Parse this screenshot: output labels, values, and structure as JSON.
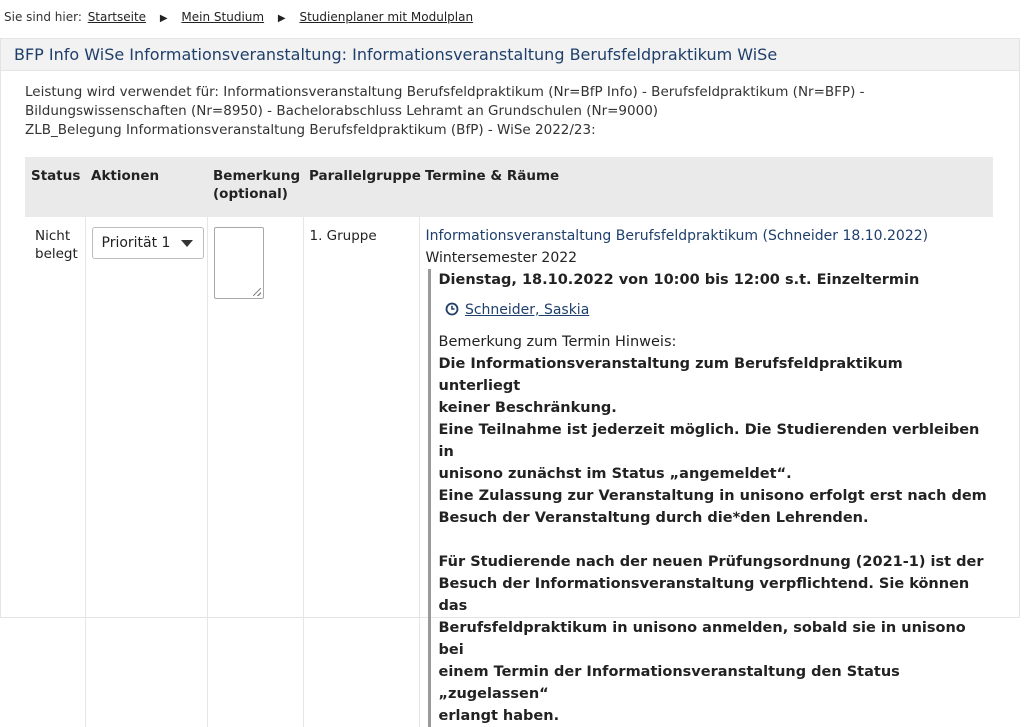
{
  "breadcrumb": {
    "prefix": "Sie sind hier:",
    "items": [
      "Startseite",
      "Mein Studium",
      "Studienplaner mit Modulplan"
    ]
  },
  "panel": {
    "title": "BFP Info WiSe Informationsveranstaltung: Informationsveranstaltung Berufsfeldpraktikum WiSe",
    "usage_lines": [
      "Leistung wird verwendet für: Informationsveranstaltung Berufsfeldpraktikum (Nr=BfP Info) - Berufsfeldpraktikum (Nr=BFP) -",
      "Bildungswissenschaften (Nr=8950) - Bachelorabschluss Lehramt an Grundschulen (Nr=9000)",
      "ZLB_Belegung Informationsveranstaltung Berufsfeldpraktikum (BfP) - WiSe 2022/23:"
    ]
  },
  "table": {
    "headers": [
      "Status",
      "Aktionen",
      "Bemerkung (optional)",
      "Parallelgruppe",
      "Termine & Räume"
    ],
    "row": {
      "status": "Nicht belegt",
      "priority_selected": "Priorität 1",
      "parallel_group": "1. Gruppe",
      "event_link": "Informationsveranstaltung Berufsfeldpraktikum (Schneider 18.10.2022)",
      "semester": "Wintersemester 2022",
      "date_line": "Dienstag, 18.10.2022 von 10:00 bis 12:00 s.t. Einzeltermin",
      "lecturer": "Schneider, Saskia",
      "remark_heading": "Bemerkung zum Termin Hinweis:",
      "remark_lines": [
        "Die Informationsveranstaltung zum Berufsfeldpraktikum unterliegt",
        "keiner Beschränkung.",
        "Eine Teilnahme ist jederzeit möglich. Die Studierenden verbleiben in",
        "unisono zunächst im Status „angemeldet“.",
        "Eine Zulassung zur Veranstaltung in unisono erfolgt erst nach dem",
        "Besuch der Veranstaltung durch die*den Lehrenden."
      ],
      "remark_lines_2": [
        "Für Studierende nach der neuen Prüfungsordnung (2021-1) ist der",
        "Besuch der Informationsveranstaltung verpflichtend. Sie können das",
        "Berufsfeldpraktikum in unisono anmelden, sobald sie in unisono bei",
        "einem Termin der Informationsveranstaltung den Status „zugelassen“",
        "erlangt haben."
      ]
    }
  },
  "colors": {
    "link": "#1f3f6b",
    "header_bg": "#eaeaea",
    "title_bg": "#f2f2f2"
  },
  "icons": {
    "lecturer": "clock-icon",
    "dropdown": "chevron-down-icon",
    "breadcrumb_separator": "triangle-right-icon"
  }
}
